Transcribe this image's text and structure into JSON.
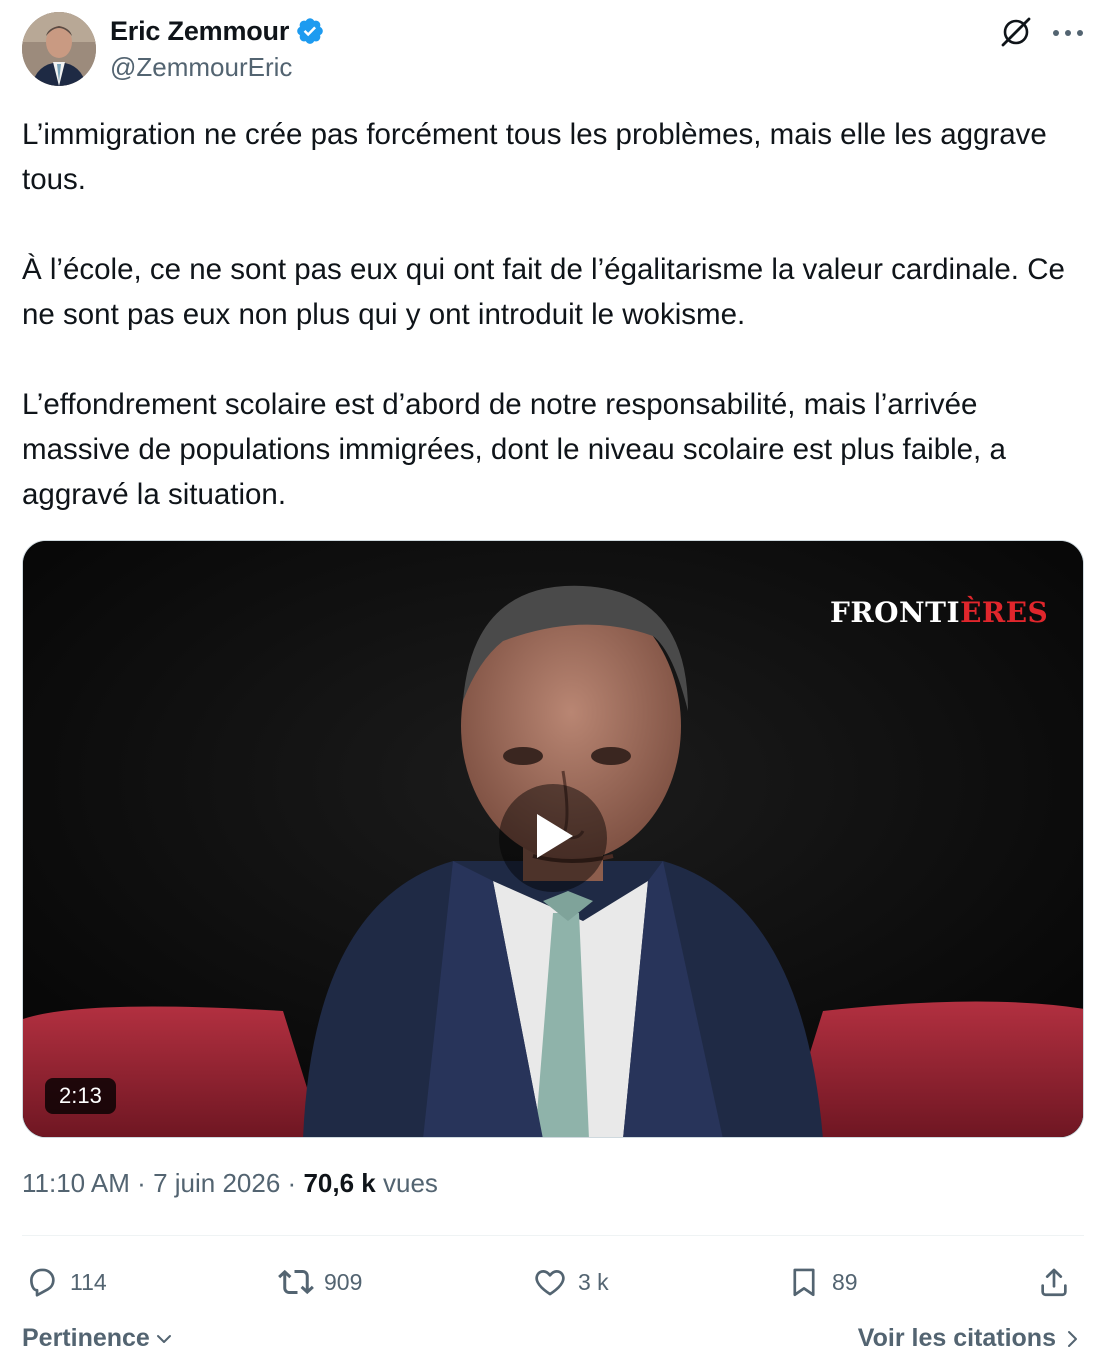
{
  "author": {
    "display_name": "Eric Zemmour",
    "handle": "@ZemmourEric",
    "verified": true
  },
  "tweet": {
    "paragraphs": [
      "L’immigration ne crée pas forcément tous les problèmes, mais elle les aggrave tous.",
      "À l’école, ce ne sont pas eux qui ont fait de l’égalitarisme la valeur cardinale. Ce ne sont pas eux non plus qui y ont introduit le wokisme.",
      "L’effondrement scolaire est d’abord de notre responsabilité, mais l’arrivée massive de populations immigrées, dont le niveau scolaire est plus faible, a aggravé la situation."
    ]
  },
  "media": {
    "brand_part1": "FRONTI",
    "brand_part2": "ÈRES",
    "duration": "2:13"
  },
  "meta": {
    "time": "11:10 AM",
    "separator": "·",
    "date": "7 juin 2026",
    "views_count": "70,6 k",
    "views_label": "vues"
  },
  "actions": {
    "replies": "114",
    "reposts": "909",
    "likes": "3 k",
    "bookmarks": "89"
  },
  "footer": {
    "sort_label": "Pertinence",
    "quotes_label": "Voir les citations"
  },
  "colors": {
    "text_primary": "#0f1419",
    "text_secondary": "#536471",
    "verified_blue": "#1d9bf0",
    "brand_red": "#e0262c"
  },
  "icons": {
    "grok": "grok-icon",
    "more": "more-icon",
    "verified": "verified-badge-icon",
    "reply": "reply-icon",
    "repost": "repost-icon",
    "like": "heart-icon",
    "bookmark": "bookmark-icon",
    "share": "share-icon",
    "play": "play-icon"
  }
}
